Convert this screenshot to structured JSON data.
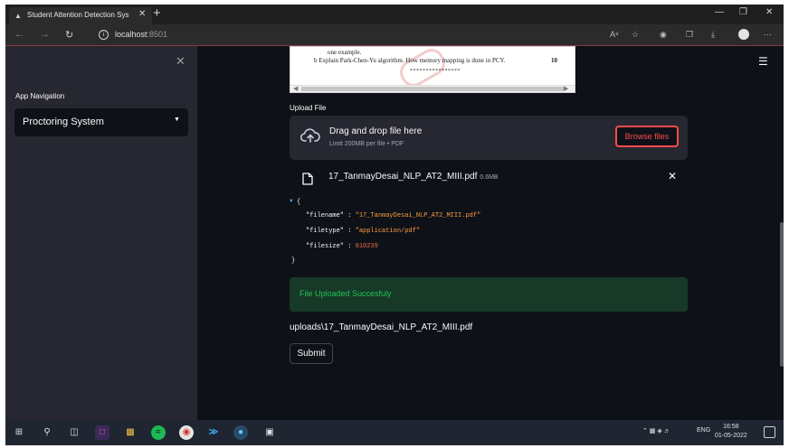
{
  "browser": {
    "tab_title": "Student Attention Detection Sys",
    "url_host": "localhost",
    "url_port": ":8501"
  },
  "sidebar": {
    "nav_title": "App Navigation",
    "selected_page": "Proctoring System"
  },
  "pdf_preview": {
    "line1": "one example.",
    "line2": "b  Explain Park-Chen-Yu algorithm. How memory mapping is done in PCY.",
    "marks": "10",
    "divider": "****************"
  },
  "uploader": {
    "label": "Upload File",
    "drop_text": "Drag and drop file here",
    "limit_text": "Limit 200MB per file • PDF",
    "browse_label": "Browse files"
  },
  "uploaded_file": {
    "name": "17_TanmayDesai_NLP_AT2_MIII.pdf",
    "size": "0.6MB"
  },
  "file_details": {
    "filename": "17_TanmayDesai_NLP_AT2_MIII.pdf",
    "filetype": "application/pdf",
    "filesize": "610239"
  },
  "status_message": "File Uploaded Succesfuly",
  "saved_path": "uploads\\17_TanmayDesai_NLP_AT2_MIII.pdf",
  "submit_label": "Submit",
  "taskbar": {
    "language": "ENG",
    "time": "16:58",
    "date": "01-05-2022"
  }
}
